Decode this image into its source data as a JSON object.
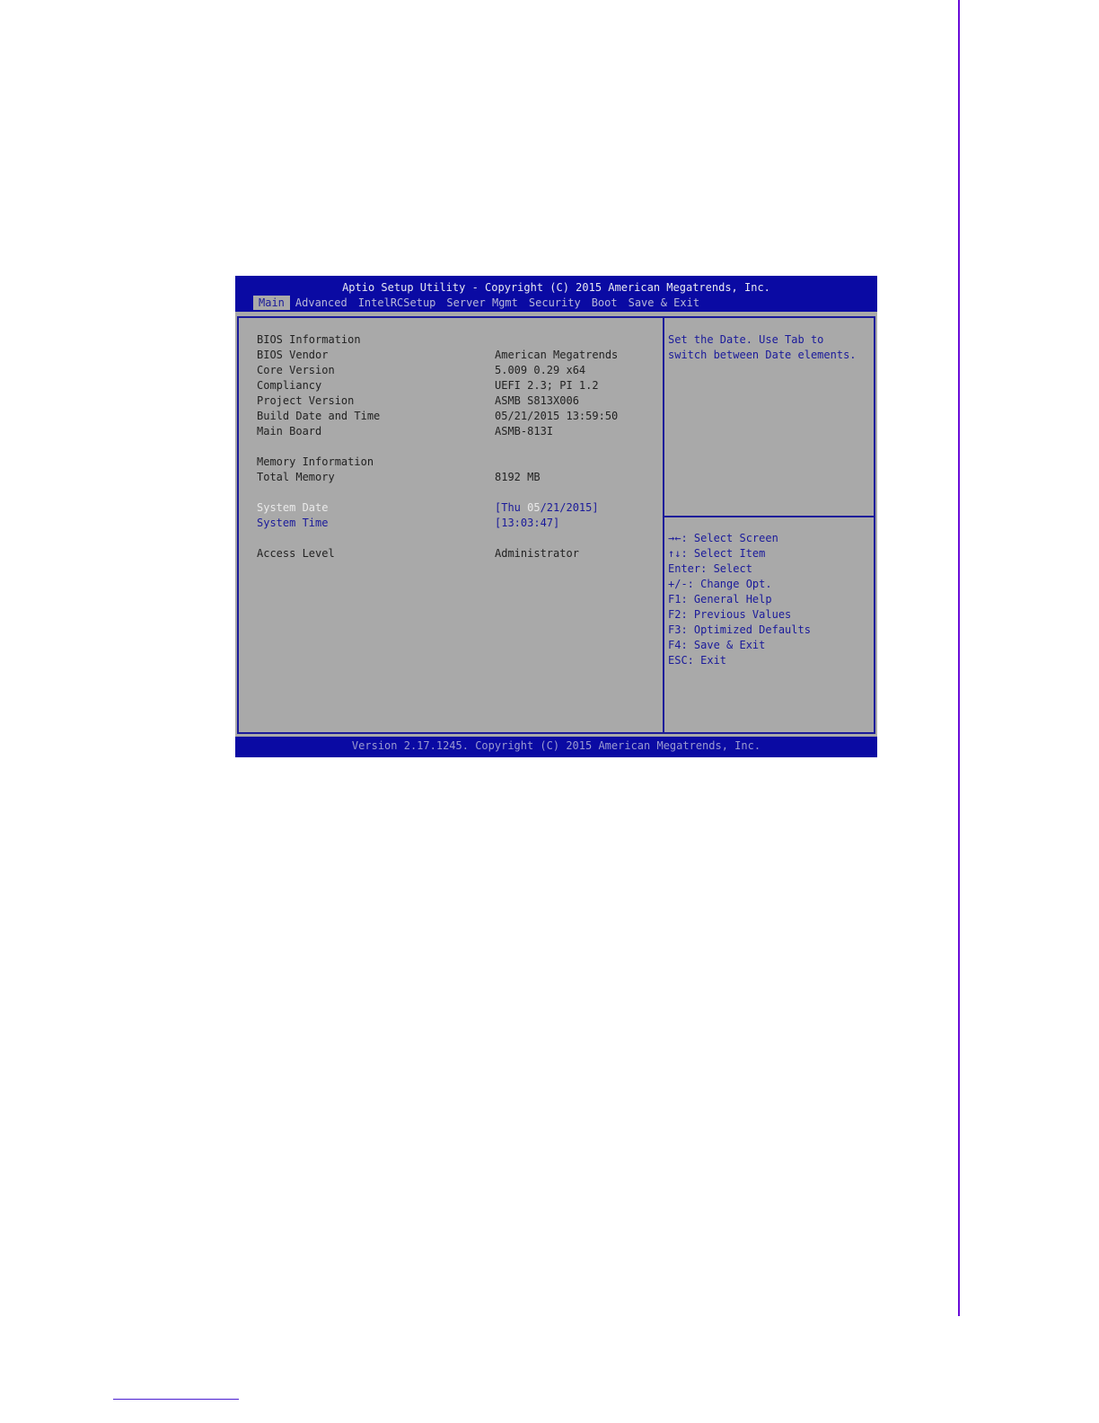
{
  "bios": {
    "title": "Aptio Setup Utility - Copyright (C) 2015 American Megatrends, Inc.",
    "tabs": [
      {
        "label": "Main",
        "active": true
      },
      {
        "label": "Advanced"
      },
      {
        "label": "IntelRCSetup"
      },
      {
        "label": "Server Mgmt"
      },
      {
        "label": "Security"
      },
      {
        "label": "Boot"
      },
      {
        "label": "Save & Exit"
      }
    ],
    "main": {
      "bios_info_heading": "BIOS Information",
      "bios_vendor_label": "BIOS Vendor",
      "bios_vendor_value": "American Megatrends",
      "core_version_label": "Core Version",
      "core_version_value": "5.009 0.29 x64",
      "compliancy_label": "Compliancy",
      "compliancy_value": "UEFI 2.3; PI 1.2",
      "project_version_label": "Project Version",
      "project_version_value": "ASMB S813X006",
      "build_date_label": "Build Date and Time",
      "build_date_value": "05/21/2015 13:59:50",
      "main_board_label": "Main Board",
      "main_board_value": "ASMB-813I",
      "memory_info_heading": "Memory Information",
      "total_memory_label": "Total Memory",
      "total_memory_value": "8192 MB",
      "system_date_label": "System Date",
      "system_date_prefix": "[Thu ",
      "system_date_selected": "05",
      "system_date_suffix": "/21/2015]",
      "system_time_label": "System Time",
      "system_time_value": "[13:03:47]",
      "access_level_label": "Access Level",
      "access_level_value": "Administrator"
    },
    "help": {
      "line1": "Set the Date. Use Tab to",
      "line2": "switch between Date elements."
    },
    "keys": [
      "→←: Select Screen",
      "↑↓: Select Item",
      "Enter: Select",
      "+/-: Change Opt.",
      "F1: General Help",
      "F2: Previous Values",
      "F3: Optimized Defaults",
      "F4: Save & Exit",
      "ESC: Exit"
    ],
    "status": "Version 2.17.1245. Copyright (C) 2015 American Megatrends, Inc."
  }
}
